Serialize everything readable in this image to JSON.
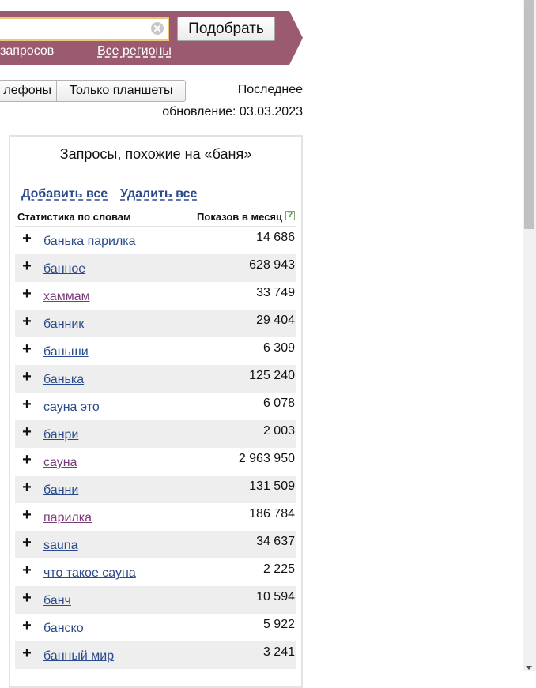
{
  "search": {
    "button_label": "Подобрать",
    "queries_link": "запросов",
    "regions_link": "Все регионы"
  },
  "devices": {
    "phones_label": "лефоны",
    "tablets_label": "Только планшеты"
  },
  "update": {
    "line1": "Последнее",
    "line2": "обновление: 03.03.2023"
  },
  "panel": {
    "title": "Запросы, похожие на «баня»",
    "add_all": "Добавить все",
    "remove_all": "Удалить все",
    "col_words": "Статистика по словам",
    "col_shows": "Показов в месяц",
    "help_glyph": "?",
    "plus_glyph": "+",
    "rows": [
      {
        "word": "банька парилка",
        "count": "14 686",
        "visited": false
      },
      {
        "word": "банное",
        "count": "628 943",
        "visited": false
      },
      {
        "word": "хаммам",
        "count": "33 749",
        "visited": true
      },
      {
        "word": "банник",
        "count": "29 404",
        "visited": false
      },
      {
        "word": "баньши",
        "count": "6 309",
        "visited": false
      },
      {
        "word": "банька",
        "count": "125 240",
        "visited": false
      },
      {
        "word": "сауна это",
        "count": "6 078",
        "visited": false
      },
      {
        "word": "банри",
        "count": "2 003",
        "visited": false
      },
      {
        "word": "сауна",
        "count": "2 963 950",
        "visited": true
      },
      {
        "word": "банни",
        "count": "131 509",
        "visited": false
      },
      {
        "word": "парилка",
        "count": "186 784",
        "visited": true
      },
      {
        "word": "sauna",
        "count": "34 637",
        "visited": false
      },
      {
        "word": "что такое сауна",
        "count": "2 225",
        "visited": false
      },
      {
        "word": "банч",
        "count": "10 594",
        "visited": false
      },
      {
        "word": "банско",
        "count": "5 922",
        "visited": false
      },
      {
        "word": "банный мир",
        "count": "3 241",
        "visited": false
      }
    ]
  },
  "colors": {
    "band": "#9c5a70",
    "link": "#2b4a8b",
    "visited_link": "#7a3b7a",
    "row_alt": "#eeeeee"
  },
  "icons": {
    "clear": "clear-icon",
    "help": "help-icon",
    "add": "plus-icon"
  }
}
